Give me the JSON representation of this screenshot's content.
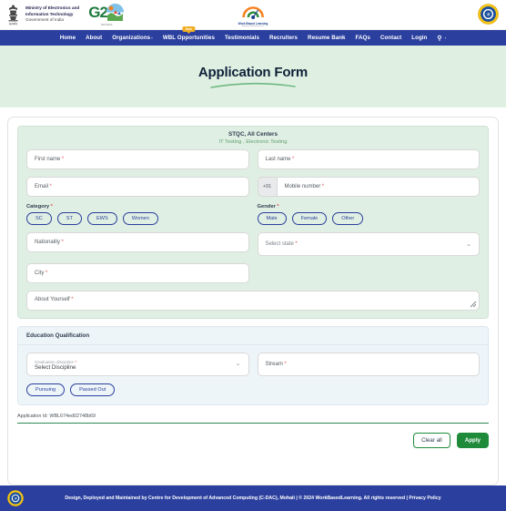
{
  "header": {
    "ministry_line1": "Ministry of Electronics and",
    "ministry_line2": "Information Technology",
    "ministry_line3": "Government of India",
    "g20_text": "G2",
    "g20_caption": "भारत  INDIA",
    "wbl_name": "Work Based Learning",
    "wbl_sub": "Ministry of Electronics & IT",
    "emblem_icon": "india-emblem-icon",
    "g20_icon": "g20-logo-icon",
    "wbl_icon": "wbl-logo-icon",
    "seal_icon": "government-seal-icon"
  },
  "nav": {
    "items": [
      {
        "label": "Home",
        "caret": false,
        "badge": ""
      },
      {
        "label": "About",
        "caret": false,
        "badge": ""
      },
      {
        "label": "Organizations",
        "caret": true,
        "badge": ""
      },
      {
        "label": "WBL Opportunities",
        "caret": false,
        "badge": "New"
      },
      {
        "label": "Testimonials",
        "caret": false,
        "badge": ""
      },
      {
        "label": "Recruiters",
        "caret": false,
        "badge": ""
      },
      {
        "label": "Resume Bank",
        "caret": false,
        "badge": ""
      },
      {
        "label": "FAQs",
        "caret": false,
        "badge": ""
      },
      {
        "label": "Contact",
        "caret": false,
        "badge": ""
      },
      {
        "label": "Login",
        "caret": false,
        "badge": ""
      }
    ],
    "accessibility_icon": "accessibility-icon",
    "accessibility_caret": "-"
  },
  "hero": {
    "title": "Application Form"
  },
  "form": {
    "org_title": "STQC, All Centers",
    "org_subtitle": "IT Testing , Electronic Testing",
    "fields": {
      "first_name": "First name",
      "last_name": "Last name",
      "email": "Email",
      "phone_prefix": "+91",
      "mobile_number": "Mobile number",
      "nationality": "Nationality",
      "select_state": "Select state",
      "city": "City",
      "about_yourself": "About Yourself"
    },
    "category": {
      "label": "Category",
      "options": [
        "SC",
        "ST",
        "EWS",
        "Women"
      ]
    },
    "gender": {
      "label": "Gender",
      "options": [
        "Male",
        "Female",
        "Other"
      ]
    },
    "required_marker": "*"
  },
  "education": {
    "section_title": "Education Qualification",
    "discipline_label": "Graduation discipline",
    "discipline_value": "Select Discipline",
    "stream_label": "Stream",
    "status_options": [
      "Pursuing",
      "Passed Out"
    ]
  },
  "application": {
    "id_text": "Application Id: WBL674ed02748b69"
  },
  "actions": {
    "clear_label": "Clear all",
    "apply_label": "Apply"
  },
  "footer": {
    "text": "Design, Deployed and Maintained by Centre for Development of Advanced Computing (C-DAC), Mohali | © 2024 WorkBasedLearning. All rights reserved | Privacy Policy",
    "seal_icon": "government-seal-icon"
  },
  "colors": {
    "nav_blue": "#2b3f9e",
    "hero_green": "#dff0e2",
    "panel_green": "#e0efe3",
    "panel_blue": "#eef5f9",
    "accent_green": "#1f8b3a",
    "required_red": "#d9534f",
    "badge_amber": "#f0ad21"
  }
}
